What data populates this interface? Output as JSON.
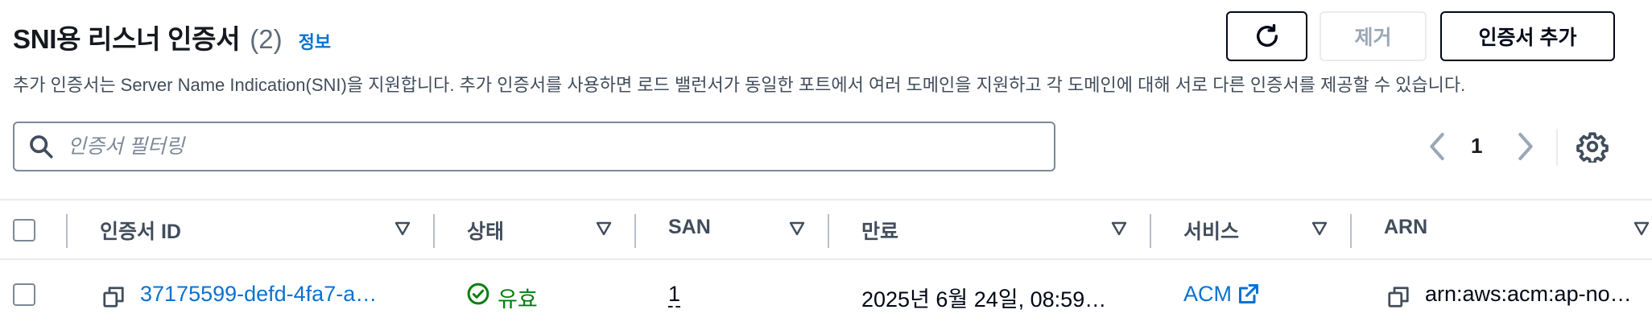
{
  "header": {
    "title": "SNI용 리스너 인증서",
    "count": "(2)",
    "info_link": "정보",
    "description": "추가 인증서는 Server Name Indication(SNI)을 지원합니다. 추가 인증서를 사용하면 로드 밸런서가 동일한 포트에서 여러 도메인을 지원하고 각 도메인에 대해 서로 다른 인증서를 제공할 수 있습니다."
  },
  "actions": {
    "refresh_icon": "refresh-icon",
    "remove_label": "제거",
    "add_label": "인증서 추가"
  },
  "filter": {
    "placeholder": "인증서 필터링",
    "value": ""
  },
  "pagination": {
    "current_page": "1"
  },
  "table": {
    "columns": [
      "인증서 ID",
      "상태",
      "SAN",
      "만료",
      "서비스",
      "ARN"
    ],
    "rows": [
      {
        "certificate_id": "37175599-defd-4fa7-a…",
        "status": "유효",
        "san": "1",
        "expiry": "2025년 6월 24일, 08:59…",
        "service": "ACM",
        "arn": "arn:aws:acm:ap-no…"
      }
    ]
  },
  "colors": {
    "link": "#0972d3",
    "success": "#037f0c",
    "border": "#7d8998",
    "text": "#16191f"
  }
}
